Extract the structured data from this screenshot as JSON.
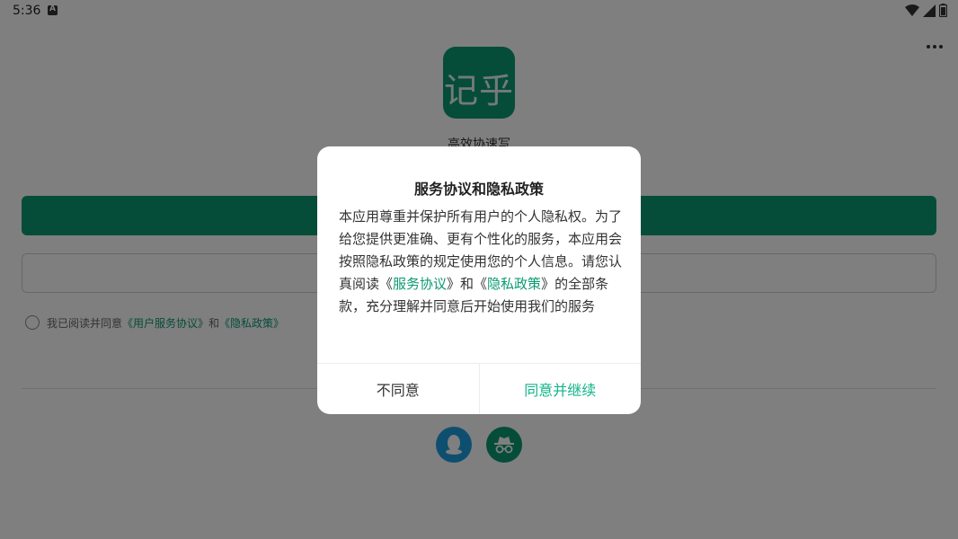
{
  "status_bar": {
    "time": "5:36"
  },
  "app": {
    "logo_text": "记乎",
    "slogan": "高效协速写"
  },
  "agreement_row": {
    "prefix": "我已阅读并同意",
    "user_agreement_link": "《用户服务协议》",
    "and": "和",
    "privacy_link": "《隐私政策》"
  },
  "dialog": {
    "title": "服务协议和隐私政策",
    "body_part1": "本应用尊重并保护所有用户的个人隐私权。为了给您提供更准确、更有个性化的服务，本应用会按照隐私政策的规定使用您的个人信息。请您认真阅读《",
    "link_service": "服务协议",
    "body_part2": "》和《",
    "link_privacy": "隐私政策",
    "body_part3": "》的全部条款，充分理解并同意后开始使用我们的服务",
    "disagree_label": "不同意",
    "agree_label": "同意并继续"
  },
  "colors": {
    "brand": "#0b9a72",
    "accent_link": "#12b48a",
    "qq_blue": "#1d9ee0"
  },
  "icons": [
    "wifi-icon",
    "signal-icon",
    "battery-icon",
    "more-icon",
    "qq-icon",
    "incognito-icon"
  ]
}
